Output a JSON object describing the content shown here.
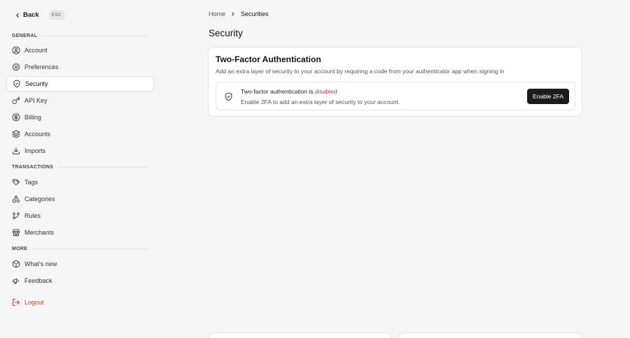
{
  "sidebar": {
    "back_label": "Back",
    "esc_label": "ESC",
    "sections": {
      "general": "GENERAL",
      "transactions": "TRANSACTIONS",
      "more": "MORE"
    },
    "items": [
      {
        "label": "Account",
        "icon": "user-circle-icon",
        "active": false
      },
      {
        "label": "Preferences",
        "icon": "gear-icon",
        "active": false
      },
      {
        "label": "Security",
        "icon": "shield-check-icon",
        "active": true
      },
      {
        "label": "API Key",
        "icon": "key-icon",
        "active": false
      },
      {
        "label": "Billing",
        "icon": "dollar-circle-icon",
        "active": false
      },
      {
        "label": "Accounts",
        "icon": "layers-icon",
        "active": false
      },
      {
        "label": "Imports",
        "icon": "download-icon",
        "active": false
      },
      {
        "label": "Tags",
        "icon": "tags-icon",
        "active": false
      },
      {
        "label": "Categories",
        "icon": "shapes-icon",
        "active": false
      },
      {
        "label": "Rules",
        "icon": "git-branch-icon",
        "active": false
      },
      {
        "label": "Merchants",
        "icon": "store-icon",
        "active": false
      },
      {
        "label": "What's new",
        "icon": "box-icon",
        "active": false
      },
      {
        "label": "Feedback",
        "icon": "megaphone-icon",
        "active": false
      },
      {
        "label": "Logout",
        "icon": "logout-icon",
        "active": false
      }
    ]
  },
  "breadcrumb": {
    "home": "Home",
    "current": "Securities"
  },
  "page_title": "Security",
  "two_factor": {
    "title": "Two-Factor Authentication",
    "description": "Add an extra layer of security to your account by requiring a code from your authenticator app when signing in",
    "status_prefix": "Two-factor authentication is",
    "status_value": "disabled",
    "status_description": "Enable 2FA to add an extra layer of security to your account.",
    "button_label": "Enable 2FA"
  },
  "colors": {
    "accent": "#1c1c1c",
    "danger": "#d9382b",
    "background": "#f6f6f6",
    "card": "#ffffff"
  }
}
